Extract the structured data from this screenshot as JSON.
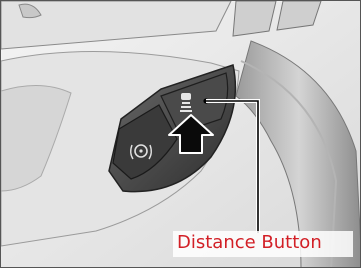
{
  "figure": {
    "callout_label": "Distance Button",
    "callout_color": "#d21f26"
  },
  "icons": {
    "distance_button_symbol": "vehicle-distance-icon",
    "adjacent_button_symbol": "steering-assist-icon",
    "press_arrow": "up-arrow-icon"
  }
}
